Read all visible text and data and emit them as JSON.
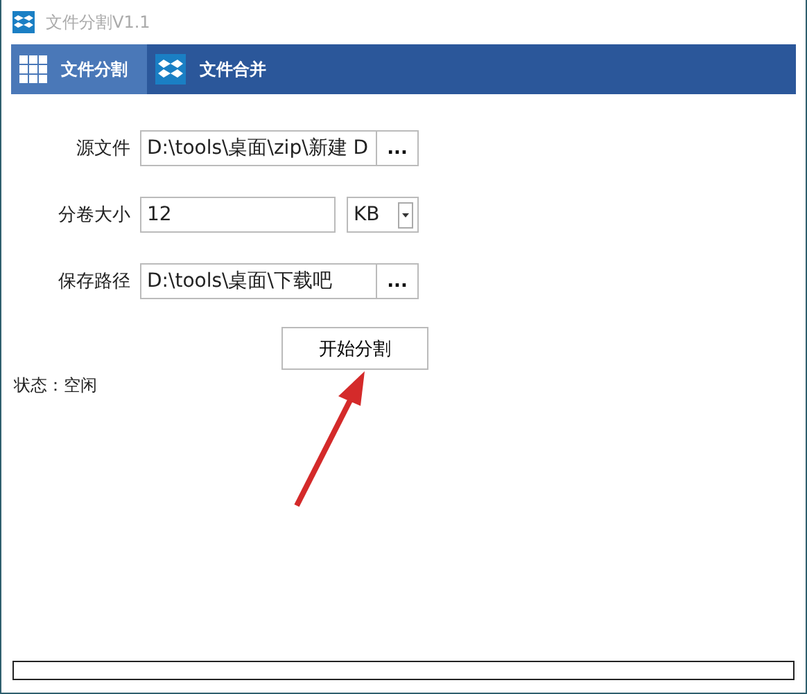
{
  "window": {
    "title": "文件分割V1.1"
  },
  "tabs": [
    {
      "label": "文件分割",
      "selected": true,
      "kind": "grid"
    },
    {
      "label": "文件合并",
      "selected": false,
      "kind": "box"
    }
  ],
  "form": {
    "source_file": {
      "label": "源文件",
      "value": "D:\\tools\\桌面\\zip\\新建 D",
      "browse": "..."
    },
    "volume_size": {
      "label": "分卷大小",
      "value": "12",
      "unit": "KB"
    },
    "save_path": {
      "label": "保存路径",
      "value": "D:\\tools\\桌面\\下载吧",
      "browse": "..."
    }
  },
  "start_button": {
    "label": "开始分割"
  },
  "status": {
    "text": "状态：空闲"
  },
  "progress": {
    "level": 0
  }
}
